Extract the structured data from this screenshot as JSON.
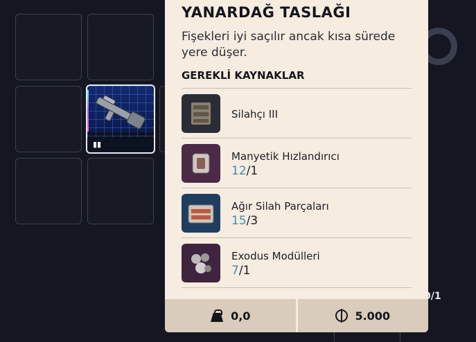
{
  "blueprint": {
    "title": "YANARDAĞ TASLAĞI",
    "description": "Fişekleri iyi saçılır ancak kısa sürede yere düşer.",
    "requirements_header": "GEREKLİ KAYNAKLAR",
    "requirements": [
      {
        "name": "Silahçı III",
        "have": "",
        "sep": "",
        "need": "",
        "icon": "workbench-icon",
        "color": "#2a2d36"
      },
      {
        "name": "Manyetik Hızlandırıcı",
        "have": "12",
        "sep": "/",
        "need": "1",
        "icon": "magnetic-accelerator-icon",
        "color": "#4a2a47"
      },
      {
        "name": "Ağır Silah Parçaları",
        "have": "15",
        "sep": "/",
        "need": "3",
        "icon": "heavy-gun-parts-icon",
        "color": "#1f3d5e"
      },
      {
        "name": "Exodus Modülleri",
        "have": "7",
        "sep": "/",
        "need": "1",
        "icon": "exodus-modules-icon",
        "color": "#3f2440"
      }
    ],
    "weight": "0,0",
    "price": "5.000"
  },
  "background": {
    "side_count": "0/1"
  },
  "colors": {
    "panel_bg": "#f6ecdf",
    "footer_bg": "#d9ccbb",
    "have_count": "#3d8eb6",
    "page_bg": "#141722"
  }
}
